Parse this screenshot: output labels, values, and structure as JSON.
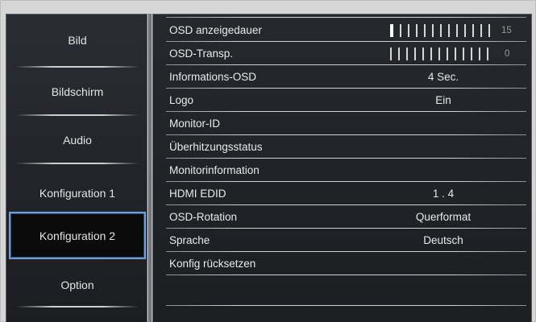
{
  "sidebar": {
    "items": [
      {
        "label": "Bild",
        "selected": false
      },
      {
        "label": "Bildschirm",
        "selected": false
      },
      {
        "label": "Audio",
        "selected": false
      },
      {
        "label": "Konfiguration 1",
        "selected": false
      },
      {
        "label": "Konfiguration 2",
        "selected": true
      },
      {
        "label": "Option",
        "selected": false
      }
    ]
  },
  "main": {
    "rows": [
      {
        "label": "OSD anzeigedauer",
        "type": "slider",
        "value": "15",
        "level": 15
      },
      {
        "label": "OSD-Transp.",
        "type": "slider",
        "value": "0",
        "level": 0
      },
      {
        "label": "Informations-OSD",
        "value": "4 Sec."
      },
      {
        "label": "Logo",
        "value": "Ein"
      },
      {
        "label": "Monitor-ID",
        "value": ""
      },
      {
        "label": "Überhitzungsstatus",
        "value": ""
      },
      {
        "label": "Monitorinformation",
        "value": ""
      },
      {
        "label": "HDMI EDID",
        "value": "1 . 4"
      },
      {
        "label": "OSD-Rotation",
        "value": "Querformat"
      },
      {
        "label": "Sprache",
        "value": "Deutsch"
      },
      {
        "label": "Konfig rücksetzen",
        "value": ""
      }
    ]
  },
  "colors": {
    "panel_bg": "#1c1e22",
    "selection_border": "#6f9fd8",
    "text": "#eaeaea",
    "frame": "#d6d6d6"
  }
}
